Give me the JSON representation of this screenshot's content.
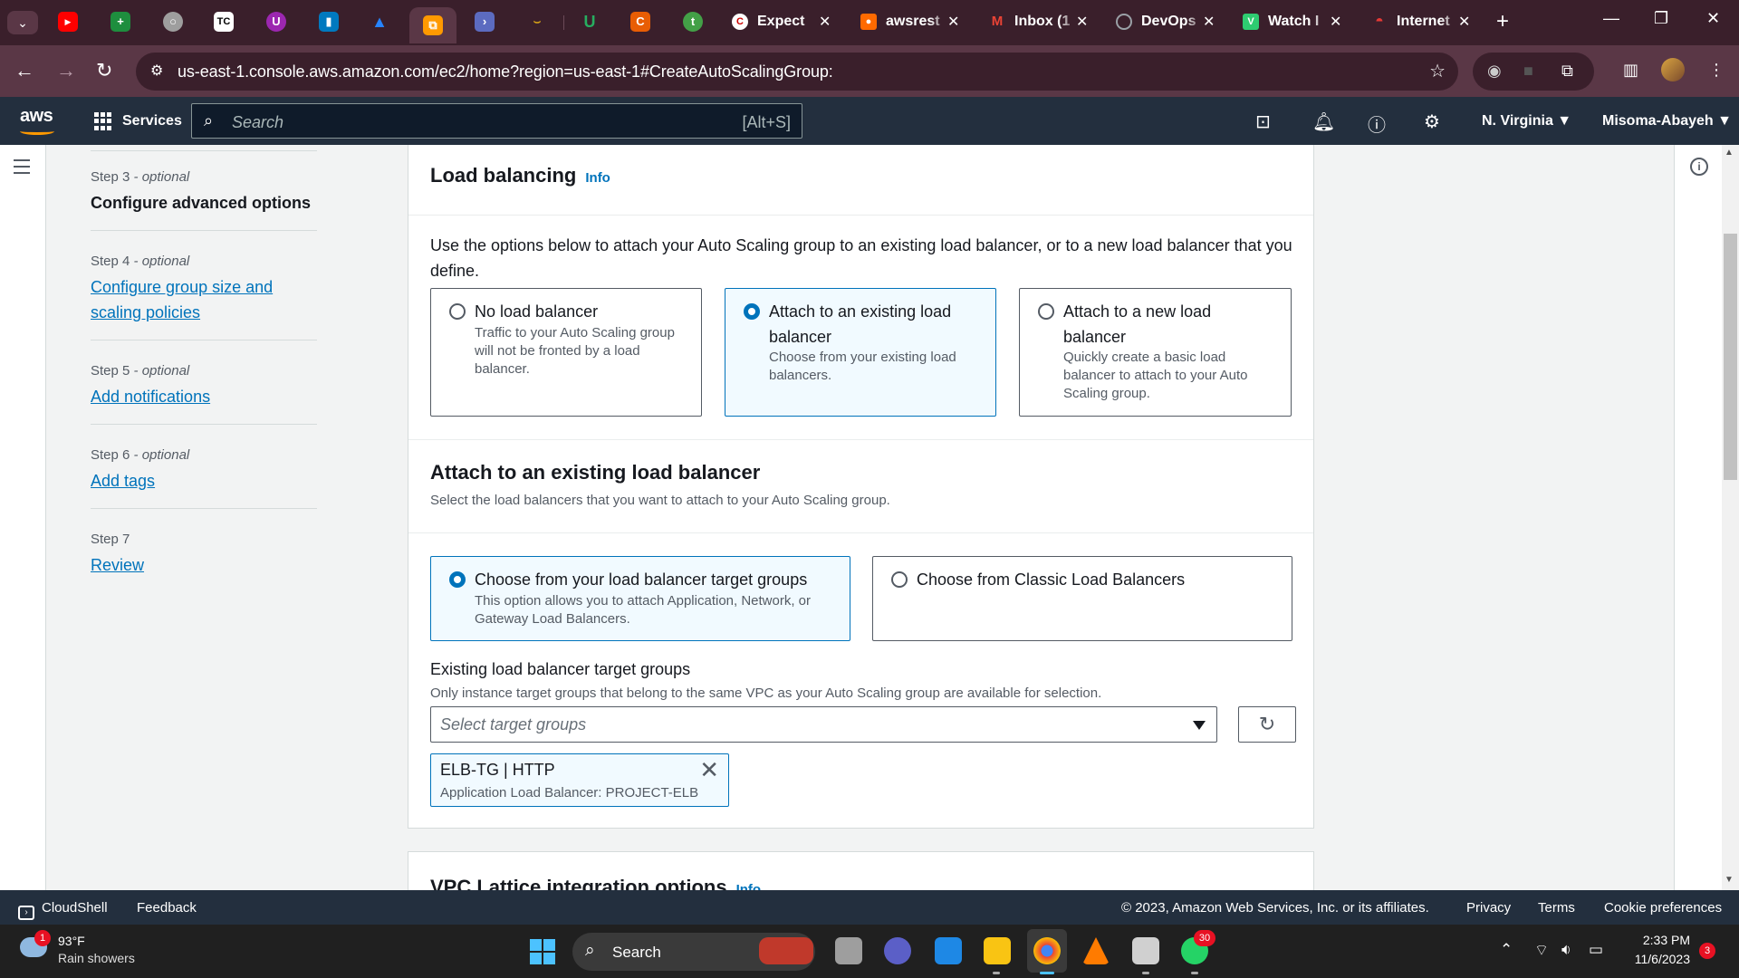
{
  "browser": {
    "tabs": [
      {
        "title": "Expect",
        "color": "#e0e0e0"
      },
      {
        "title": "awsrest",
        "color": "#ff6a00"
      },
      {
        "title": "Inbox (1",
        "color": "#ea4335"
      },
      {
        "title": "DevOps",
        "color": "#9aa0a6"
      },
      {
        "title": "Watch I",
        "color": "#2ecc71"
      },
      {
        "title": "Internet",
        "color": "#e53935"
      }
    ],
    "url": "us-east-1.console.aws.amazon.com/ec2/home?region=us-east-1#CreateAutoScalingGroup:"
  },
  "aws_nav": {
    "logo": "aws",
    "services": "Services",
    "search_placeholder": "Search",
    "search_shortcut": "[Alt+S]",
    "region": "N. Virginia ▼",
    "account": "Misoma-Abayeh ▼"
  },
  "steps": [
    {
      "label": "Step 3",
      "optional": " - optional",
      "title": "Configure advanced options",
      "current": true
    },
    {
      "label": "Step 4",
      "optional": " - optional",
      "title": "Configure group size and scaling policies",
      "current": false
    },
    {
      "label": "Step 5",
      "optional": " - optional",
      "title": "Add notifications",
      "current": false
    },
    {
      "label": "Step 6",
      "optional": " - optional",
      "title": "Add tags",
      "current": false
    },
    {
      "label": "Step 7",
      "optional": "",
      "title": "Review",
      "current": false
    }
  ],
  "load_balancing": {
    "title": "Load balancing",
    "info": "Info",
    "description": "Use the options below to attach your Auto Scaling group to an existing load balancer, or to a new load balancer that you define.",
    "options": [
      {
        "title": "No load balancer",
        "desc": "Traffic to your Auto Scaling group will not be fronted by a load balancer.",
        "selected": false
      },
      {
        "title": "Attach to an existing load balancer",
        "desc": "Choose from your existing load balancers.",
        "selected": true
      },
      {
        "title": "Attach to a new load balancer",
        "desc": "Quickly create a basic load balancer to attach to your Auto Scaling group.",
        "selected": false
      }
    ]
  },
  "existing_lb": {
    "title": "Attach to an existing load balancer",
    "subtitle": "Select the load balancers that you want to attach to your Auto Scaling group.",
    "options": [
      {
        "title": "Choose from your load balancer target groups",
        "desc": "This option allows you to attach Application, Network, or Gateway Load Balancers.",
        "selected": true
      },
      {
        "title": "Choose from Classic Load Balancers",
        "desc": "",
        "selected": false
      }
    ],
    "field_label": "Existing load balancer target groups",
    "field_hint": "Only instance target groups that belong to the same VPC as your Auto Scaling group are available for selection.",
    "select_placeholder": "Select target groups",
    "selected_token": {
      "title": "ELB-TG | HTTP",
      "subtitle": "Application Load Balancer: PROJECT-ELB"
    }
  },
  "vpc_lattice": {
    "title": "VPC Lattice integration options",
    "info": "Info"
  },
  "footer": {
    "cloudshell": "CloudShell",
    "feedback": "Feedback",
    "copyright": "© 2023, Amazon Web Services, Inc. or its affiliates.",
    "privacy": "Privacy",
    "terms": "Terms",
    "cookies": "Cookie preferences"
  },
  "taskbar": {
    "weather_badge": "1",
    "temp": "93°F",
    "weather": "Rain showers",
    "search": "Search",
    "whatsapp_badge": "30",
    "time": "2:33 PM",
    "date": "11/6/2023",
    "notifications": "3"
  }
}
